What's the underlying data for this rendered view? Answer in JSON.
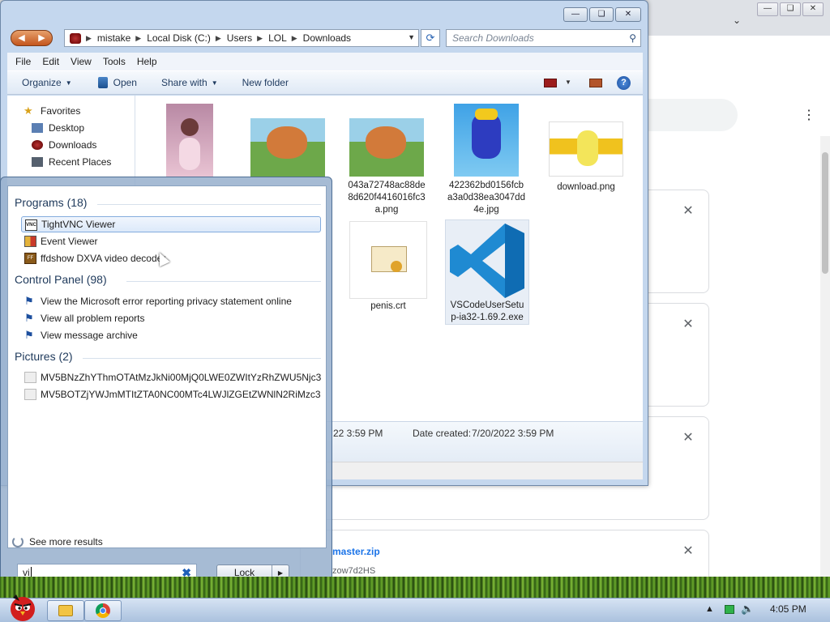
{
  "explorer": {
    "breadcrumb": [
      "mistake",
      "Local Disk (C:)",
      "Users",
      "LOL",
      "Downloads"
    ],
    "search_placeholder": "Search Downloads",
    "menu": [
      "File",
      "Edit",
      "View",
      "Tools",
      "Help"
    ],
    "commands": {
      "organize": "Organize",
      "open": "Open",
      "share_with": "Share with",
      "new_folder": "New folder"
    },
    "nav": {
      "favorites": "Favorites",
      "desktop": "Desktop",
      "downloads": "Downloads",
      "recent": "Recent Places"
    },
    "files": [
      {
        "name": "",
        "thumb": "anime-drawing"
      },
      {
        "name": "",
        "thumb": "pony-fight"
      },
      {
        "name": "043a72748ac88de8d620f4416016fc3a.png",
        "line1": "043a72748ac88de",
        "line2": "8d620f4416016fc3",
        "line3": "a.png",
        "thumb": "pony-fight"
      },
      {
        "name": "422362bd0156fcba3a0d38ea3047dd4e.jpg",
        "line1": "422362bd0156fcb",
        "line2": "a3a0d38ea3047dd",
        "line3": "4e.jpg",
        "thumb": "blue-creature"
      },
      {
        "name": "download.png",
        "line1": "download.png",
        "thumb": "yellow-creature"
      },
      {
        "name": "penis.crt",
        "line1": "penis.crt",
        "thumb": "certificate"
      },
      {
        "name": "VSCodeUserSetup-ia32-1.69.2.exe",
        "line1": "VSCodeUserSetu",
        "line2": "p-ia32-1.69.2.exe",
        "thumb": "vscode"
      }
    ],
    "details": {
      "modified_partial": "22 3:59 PM",
      "date_created_label": "Date created:",
      "date_created": "7/20/2022 3:59 PM"
    }
  },
  "start_menu": {
    "programs_header": "Programs (18)",
    "programs": [
      "TightVNC Viewer",
      "Event Viewer",
      "ffdshow DXVA video decoder"
    ],
    "control_panel_header": "Control Panel (98)",
    "control_panel": [
      "View the Microsoft error reporting privacy statement online",
      "View all problem reports",
      "View message archive"
    ],
    "pictures_header": "Pictures (2)",
    "pictures": [
      "MV5BNzZhYThmOTAtMzJkNi00MjQ0LWE0ZWItYzRhZWU5Njc3...",
      "MV5BOTZjYWJmMTItZTA0NC00MTc4LWJlZGEtZWNlN2RiMzc3..."
    ],
    "see_more": "See more results",
    "search_value": "vi",
    "lock_label": "Lock"
  },
  "chrome": {
    "downloads_partial": {
      "zip_name": "master.zip",
      "zip_sub": "zow7d2HS"
    }
  },
  "taskbar": {
    "clock": "4:05 PM"
  },
  "colors": {
    "accent": "#1f5fb8",
    "taskbar": "#c3d4ea",
    "explorer_frame": "#c4d7ee"
  }
}
